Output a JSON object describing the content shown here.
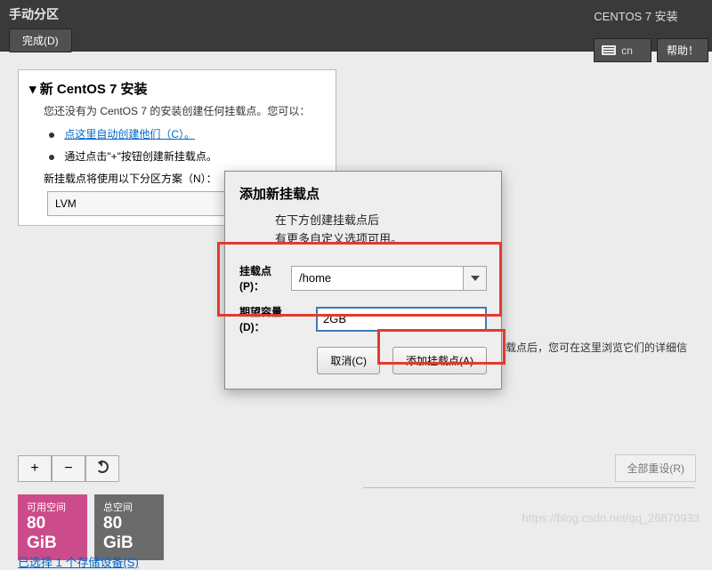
{
  "topbar": {
    "title": "手动分区",
    "done": "完成(D)",
    "product": "CENTOS 7 安装",
    "keyboard": "cn",
    "help": "帮助！"
  },
  "panel": {
    "heading": "新 CentOS 7 安装",
    "subtext": "您还没有为 CentOS 7 的安装创建任何挂载点。您可以：",
    "auto_link": "点这里自动创建他们（C）。",
    "manual_text": "通过点击\"+\"按钮创建新挂载点。",
    "scheme_text": "新挂载点将使用以下分区方案（N）：",
    "scheme_value": "LVM"
  },
  "hint": "载点后，您可在这里浏览它们的详细信",
  "toolbar": {
    "plus": "+",
    "minus": "−"
  },
  "space": {
    "avail_label": "可用空间",
    "avail_value": "80 GiB",
    "total_label": "总空间",
    "total_value": "80 GiB"
  },
  "storage_link": "已选择 1 个存储设备(S)",
  "corner_btn": "全部重设(R)",
  "dialog": {
    "title": "添加新挂载点",
    "desc_l1": "在下方创建挂载点后",
    "desc_l2": "有更多自定义选项可用。",
    "mount_label": "挂载点(P)：",
    "mount_value": "/home",
    "cap_label": "期望容量(D)：",
    "cap_value": "2GB",
    "cancel": "取消(C)",
    "add": "添加挂载点(A)"
  },
  "watermark": "https://blog.csdn.net/qq_26870933"
}
